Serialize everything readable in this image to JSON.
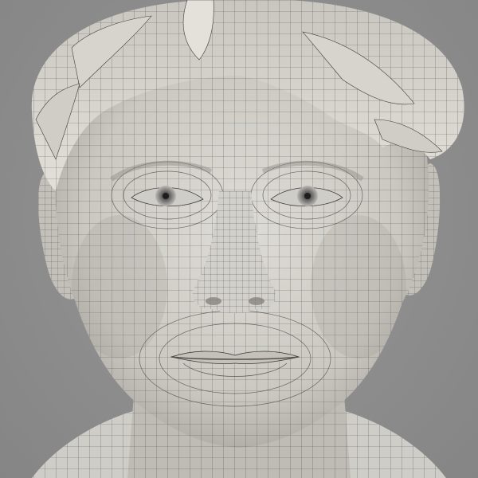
{
  "scene": {
    "subject": "wireframe-head-render",
    "colors": {
      "background": "#8e8e8e",
      "skin": "#d5d3cd",
      "skin_shadow": "#a9a6a0",
      "hair": "#dcdad3",
      "hair_shadow": "#9c9a94",
      "wire": "#3b3b3b",
      "iris": "#6b6b6b"
    }
  }
}
